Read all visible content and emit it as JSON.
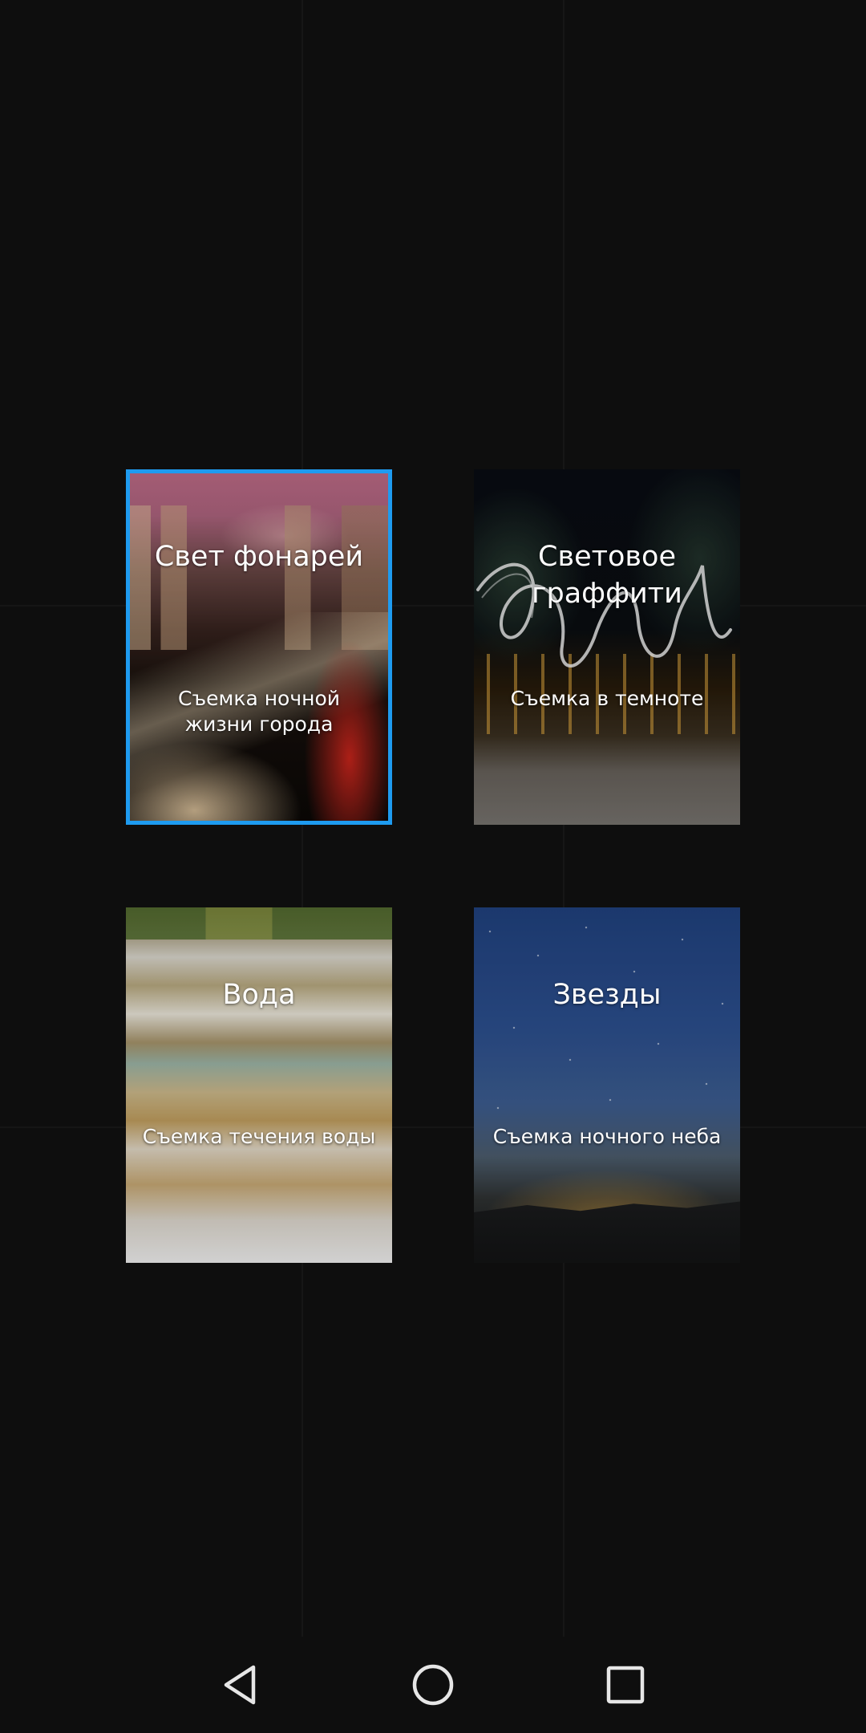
{
  "modes": [
    {
      "id": "light-painting-tail-light",
      "title": "Свет фонарей",
      "subtitle": "Съемка ночной жизни города",
      "selected": true
    },
    {
      "id": "light-graffiti",
      "title": "Световое граффити",
      "subtitle": "Съемка в темноте",
      "selected": false
    },
    {
      "id": "silky-water",
      "title": "Вода",
      "subtitle": "Съемка течения воды",
      "selected": false
    },
    {
      "id": "star-track",
      "title": "Звезды",
      "subtitle": "Съемка ночного неба",
      "selected": false
    }
  ],
  "navigation": {
    "back_icon": "back-triangle-icon",
    "home_icon": "home-circle-icon",
    "recents_icon": "recents-square-icon"
  },
  "colors": {
    "background": "#0e0e0e",
    "selection_border": "#1e9bf0",
    "text": "#ffffff",
    "nav_icon": "#e6e6e6"
  }
}
